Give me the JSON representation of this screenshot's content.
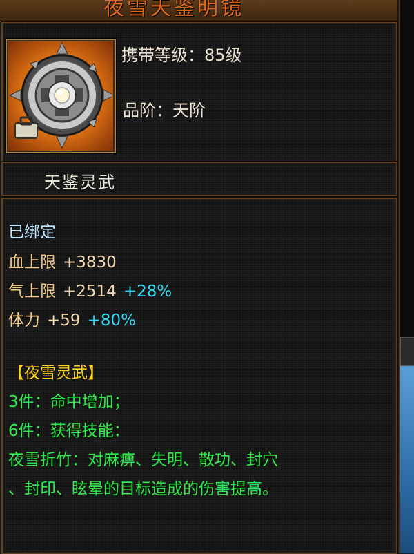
{
  "item": {
    "title": "夜雪天鉴明镜",
    "level_label": "携带等级：",
    "level_value": "85级",
    "grade_label": "品阶：",
    "grade_value": "天阶",
    "name": "天鉴灵武"
  },
  "stats": {
    "bound": "已绑定",
    "hp_label": "血上限",
    "hp_value": "+3830",
    "qi_label": "气上限",
    "qi_value": "+2514",
    "qi_bonus": "+28%",
    "sta_label": "体力",
    "sta_value": "+59",
    "sta_bonus": "+80%"
  },
  "set": {
    "name": "【夜雪灵武】",
    "piece3_count": "3件",
    "piece3_text": "：命中增加；",
    "piece6_count": "6件",
    "piece6_text": "：获得技能：",
    "skill_line1": "夜雪折竹：对麻痹、失明、散功、封穴",
    "skill_line2": "、封印、眩晕的目标造成的伤害提高。"
  },
  "colors": {
    "title": "#e06a1d",
    "bound": "#bfe8ff",
    "stat_label": "#f0c888",
    "bonus": "#35d8f0",
    "set_name": "#ffd21e",
    "set_text": "#2fe84a"
  },
  "icons": {
    "item": "mirror-shield-icon"
  }
}
